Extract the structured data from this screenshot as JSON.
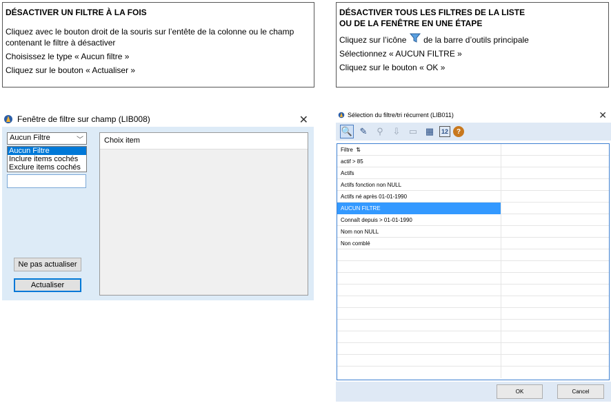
{
  "box_left": {
    "title": "DÉSACTIVER UN FILTRE À LA FOIS",
    "line1": "Cliquez avec le bouton droit de la souris sur l’entête de la colonne ou le champ",
    "line2": "contenant le filtre à désactiver",
    "line3": "Choisissez le type « Aucun filtre »",
    "line4": "Cliquez sur le bouton « Actualiser »"
  },
  "box_right": {
    "title1": "DÉSACTIVER TOUS LES FILTRES DE LA LISTE",
    "title2": "OU DE LA FENÊTRE EN UNE ÉTAPE",
    "line1_pre": "Cliquez sur l’icône",
    "line1_post": "de la barre d’outils principale",
    "line2": "Sélectionnez « AUCUN FILTRE »",
    "line3": "Cliquez sur le bouton « OK »"
  },
  "dialog1": {
    "title": "Fenêtre de filtre sur champ (LIB008)",
    "select_value": "Aucun Filtre",
    "options": [
      "Aucun Filtre",
      "Inclure items cochés",
      "Exclure items cochés"
    ],
    "btn_no_update": "Ne pas actualiser",
    "btn_update": "Actualiser",
    "choice_header": "Choix item"
  },
  "dialog2": {
    "title": "Sélection du filtre/tri récurrent (LIB011)",
    "column_header": "Filtre",
    "sort_glyph": "⇅",
    "rows": [
      "actif > 85",
      "Actifs",
      "Actifs fonction non NULL",
      "Actifs né après 01-01-1990",
      "AUCUN FILTRE",
      "Connaît depuis > 01-01-1990",
      "Nom non NULL",
      "Non comblé"
    ],
    "selected_row": "AUCUN FILTRE",
    "btn_ok": "OK",
    "btn_cancel": "Cancel",
    "calendar_day": "12"
  }
}
